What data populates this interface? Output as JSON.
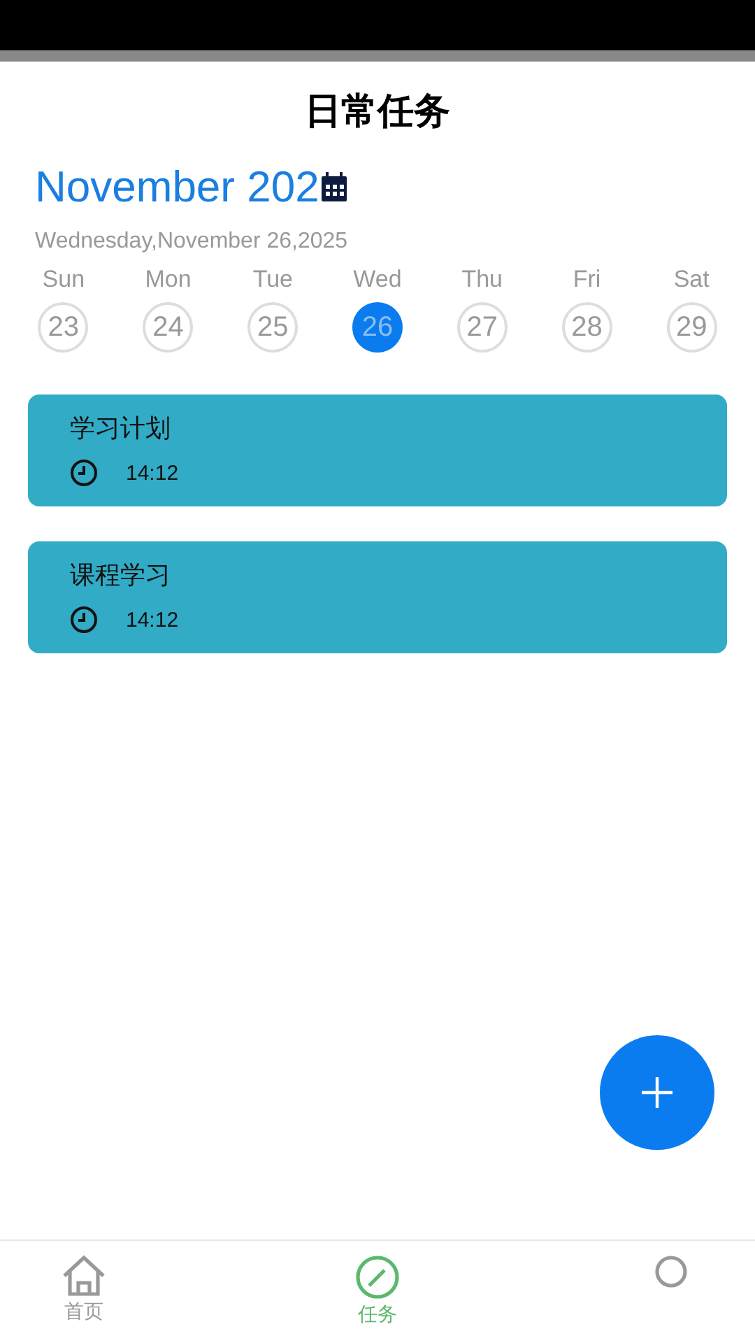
{
  "header": {
    "title": "日常任务"
  },
  "calendar": {
    "month": "November 202",
    "date": "Wednesday,November 26,2025",
    "days": [
      {
        "weekday": "Sun",
        "day": "23",
        "selected": false
      },
      {
        "weekday": "Mon",
        "day": "24",
        "selected": false
      },
      {
        "weekday": "Tue",
        "day": "25",
        "selected": false
      },
      {
        "weekday": "Wed",
        "day": "26",
        "selected": true
      },
      {
        "weekday": "Thu",
        "day": "27",
        "selected": false
      },
      {
        "weekday": "Fri",
        "day": "28",
        "selected": false
      },
      {
        "weekday": "Sat",
        "day": "29",
        "selected": false
      }
    ]
  },
  "tasks": [
    {
      "title": "学习计划",
      "time": "14:12"
    },
    {
      "title": "课程学习",
      "time": "14:12"
    }
  ],
  "tab_bar": [
    {
      "kind": "home",
      "label": "首页",
      "selected": false
    },
    {
      "kind": "tasks",
      "label": "任务",
      "selected": true
    },
    {
      "kind": "profile",
      "selected": false
    }
  ]
}
